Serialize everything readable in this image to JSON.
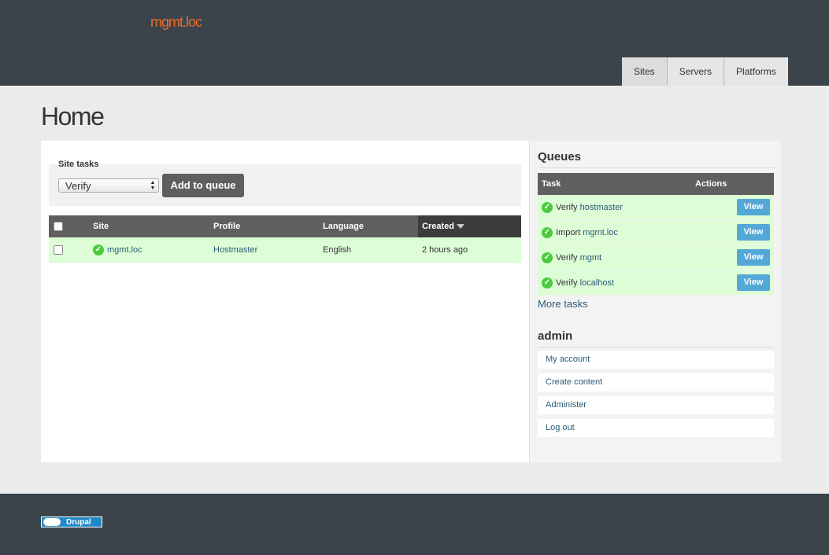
{
  "site_name": "mgmt.loc",
  "tabs": [
    {
      "label": "Sites"
    },
    {
      "label": "Servers"
    },
    {
      "label": "Platforms"
    }
  ],
  "page_title": "Home",
  "site_tasks": {
    "label": "Site tasks",
    "selected": "Verify",
    "button": "Add to queue"
  },
  "sites_table": {
    "headers": {
      "site": "Site",
      "profile": "Profile",
      "language": "Language",
      "created": "Created"
    },
    "rows": [
      {
        "site": "mgmt.loc",
        "profile": "Hostmaster",
        "language": "English",
        "created": "2 hours ago",
        "status": "ok"
      }
    ]
  },
  "queues": {
    "title": "Queues",
    "headers": {
      "task": "Task",
      "actions": "Actions"
    },
    "rows": [
      {
        "verb": "Verify",
        "target": "hostmaster",
        "action": "View"
      },
      {
        "verb": "Import",
        "target": "mgmt.loc",
        "action": "View"
      },
      {
        "verb": "Verify",
        "target": "mgmt",
        "action": "View"
      },
      {
        "verb": "Verify",
        "target": "localhost",
        "action": "View"
      }
    ],
    "more": "More tasks"
  },
  "admin": {
    "title": "admin",
    "links": [
      {
        "label": "My account"
      },
      {
        "label": "Create content"
      },
      {
        "label": "Administer"
      },
      {
        "label": "Log out"
      }
    ]
  },
  "footer": {
    "badge": "Drupal"
  },
  "colors": {
    "header_bg": "#3a444a",
    "accent": "#e96b2e",
    "success_row": "#ddfdd7",
    "button_blue": "#54a8d8"
  }
}
